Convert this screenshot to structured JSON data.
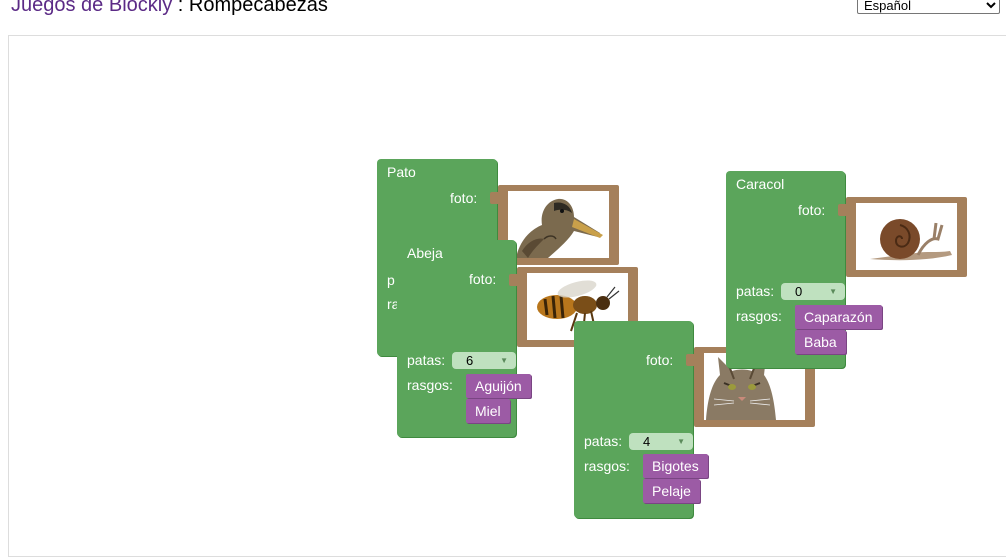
{
  "header": {
    "app_name": "Juegos de Blockly",
    "separator": " : ",
    "page_title": "Rompecabezas"
  },
  "language_select": {
    "selected": "Español"
  },
  "labels": {
    "foto": "foto:",
    "patas": "patas:",
    "rasgos": "rasgos:",
    "patas_clipped": "p",
    "rasgos_clipped": "ra"
  },
  "blocks": [
    {
      "name": "Pato",
      "legs": "",
      "traits": []
    },
    {
      "name": "Abeja",
      "legs": "6",
      "traits": [
        "Aguijón",
        "Miel"
      ]
    },
    {
      "name": "",
      "legs": "4",
      "traits": [
        "Bigotes",
        "Pelaje"
      ]
    },
    {
      "name": "Caracol",
      "legs": "0",
      "traits": [
        "Caparazón",
        "Baba"
      ]
    }
  ],
  "photos": [
    {
      "animal": "duck",
      "icon": "duck-photo"
    },
    {
      "animal": "bee",
      "icon": "bee-photo"
    },
    {
      "animal": "cat",
      "icon": "cat-photo"
    },
    {
      "animal": "snail",
      "icon": "snail-photo"
    }
  ],
  "colors": {
    "animal_block": "#5ba55b",
    "trait_block": "#9c5ba5",
    "photo_frame": "#a5805b",
    "dropdown": "#bfe1bf",
    "title_link": "#5b2a86"
  }
}
